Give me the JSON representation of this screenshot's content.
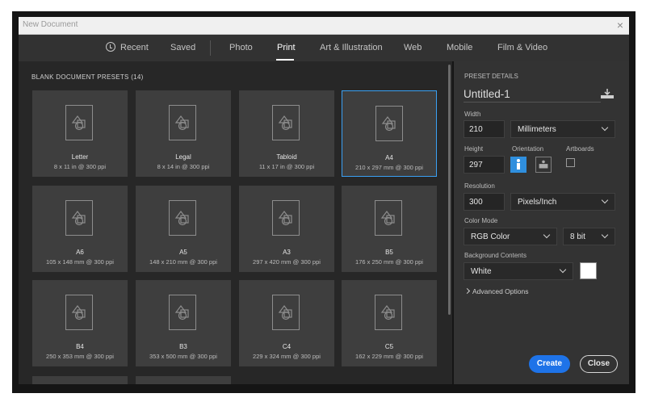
{
  "window": {
    "title": "New Document",
    "close_glyph": "×"
  },
  "tabs": [
    {
      "label": "Recent",
      "icon": "clock-icon"
    },
    {
      "label": "Saved"
    },
    {
      "label": "Photo"
    },
    {
      "label": "Print",
      "active": true
    },
    {
      "label": "Art & Illustration"
    },
    {
      "label": "Web"
    },
    {
      "label": "Mobile"
    },
    {
      "label": "Film & Video"
    }
  ],
  "presets": {
    "header": "BLANK DOCUMENT PRESETS  (14)",
    "items": [
      {
        "name": "Letter",
        "size": "8 x 11 in @ 300 ppi"
      },
      {
        "name": "Legal",
        "size": "8 x 14 in @ 300 ppi"
      },
      {
        "name": "Tabloid",
        "size": "11 x 17 in @ 300 ppi"
      },
      {
        "name": "A4",
        "size": "210 x 297 mm @ 300 ppi",
        "selected": true
      },
      {
        "name": "A6",
        "size": "105 x 148 mm @ 300 ppi"
      },
      {
        "name": "A5",
        "size": "148 x 210 mm @ 300 ppi"
      },
      {
        "name": "A3",
        "size": "297 x 420 mm @ 300 ppi"
      },
      {
        "name": "B5",
        "size": "176 x 250 mm @ 300 ppi"
      },
      {
        "name": "B4",
        "size": "250 x 353 mm @ 300 ppi"
      },
      {
        "name": "B3",
        "size": "353 x 500 mm @ 300 ppi"
      },
      {
        "name": "C4",
        "size": "229 x 324 mm @ 300 ppi"
      },
      {
        "name": "C5",
        "size": "162 x 229 mm @ 300 ppi"
      }
    ]
  },
  "details": {
    "header": "PRESET DETAILS",
    "doc_name": "Untitled-1",
    "width_label": "Width",
    "width_value": "210",
    "width_unit": "Millimeters",
    "height_label": "Height",
    "height_value": "297",
    "orientation_label": "Orientation",
    "artboards_label": "Artboards",
    "resolution_label": "Resolution",
    "resolution_value": "300",
    "resolution_unit": "Pixels/Inch",
    "color_mode_label": "Color Mode",
    "color_mode": "RGB Color",
    "bit_depth": "8 bit",
    "background_label": "Background Contents",
    "background": "White",
    "advanced_label": "Advanced Options"
  },
  "buttons": {
    "create": "Create",
    "close": "Close"
  },
  "colors": {
    "accent": "#1e73e8",
    "selected_border": "#3aa0f3",
    "panel": "#333333",
    "tile": "#3e3e3e"
  }
}
